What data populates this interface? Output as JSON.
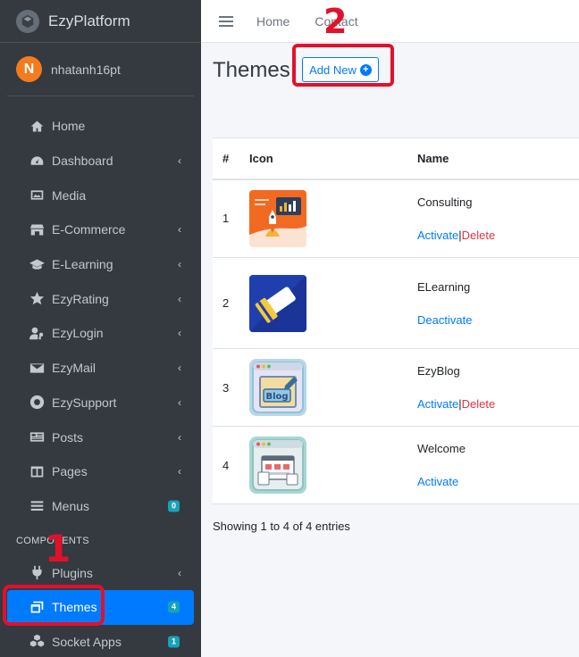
{
  "brand": {
    "name": "EzyPlatform"
  },
  "user": {
    "initial": "N",
    "name": "nhatanh16pt"
  },
  "sidebar": {
    "items": [
      {
        "label": "Home",
        "icon": "home-icon"
      },
      {
        "label": "Dashboard",
        "icon": "dashboard-icon",
        "chevron": "‹"
      },
      {
        "label": "Media",
        "icon": "image-icon"
      },
      {
        "label": "E-Commerce",
        "icon": "store-icon",
        "chevron": "‹"
      },
      {
        "label": "E-Learning",
        "icon": "graduation-cap-icon",
        "chevron": "‹"
      },
      {
        "label": "EzyRating",
        "icon": "star-icon",
        "chevron": "‹"
      },
      {
        "label": "EzyLogin",
        "icon": "user-key-icon",
        "chevron": "‹"
      },
      {
        "label": "EzyMail",
        "icon": "envelope-icon",
        "chevron": "‹"
      },
      {
        "label": "EzySupport",
        "icon": "life-ring-icon",
        "chevron": "‹"
      },
      {
        "label": "Posts",
        "icon": "newspaper-icon",
        "chevron": "‹"
      },
      {
        "label": "Pages",
        "icon": "columns-icon",
        "chevron": "‹"
      },
      {
        "label": "Menus",
        "icon": "bars-icon",
        "badge": "0"
      }
    ],
    "components_header": "COMPONENTS",
    "components": [
      {
        "label": "Plugins",
        "icon": "plug-icon",
        "chevron": "‹"
      },
      {
        "label": "Themes",
        "icon": "window-icon",
        "badge": "4",
        "active": true
      },
      {
        "label": "Socket Apps",
        "icon": "cubes-icon",
        "badge": "1"
      }
    ]
  },
  "topbar": {
    "links": [
      "Home",
      "Contact"
    ]
  },
  "page": {
    "title": "Themes",
    "add_new_label": "Add New"
  },
  "table": {
    "headers": [
      "#",
      "Icon",
      "Name"
    ],
    "rows": [
      {
        "num": "1",
        "name": "Consulting",
        "actions": [
          "Activate",
          "Delete"
        ]
      },
      {
        "num": "2",
        "name": "ELearning",
        "actions": [
          "Deactivate"
        ]
      },
      {
        "num": "3",
        "name": "EzyBlog",
        "actions": [
          "Activate",
          "Delete"
        ]
      },
      {
        "num": "4",
        "name": "Welcome",
        "actions": [
          "Activate"
        ]
      }
    ],
    "separator": "|",
    "thumb_blog_text": "Blog"
  },
  "footer": {
    "info": "Showing 1 to 4 of 4 entries"
  },
  "annotations": {
    "one": "1",
    "two": "2"
  },
  "colors": {
    "sidebar_bg": "#343a40",
    "accent": "#007bff",
    "danger": "#dc3545",
    "badge": "#17a2b8",
    "annotation": "#e3102b"
  }
}
